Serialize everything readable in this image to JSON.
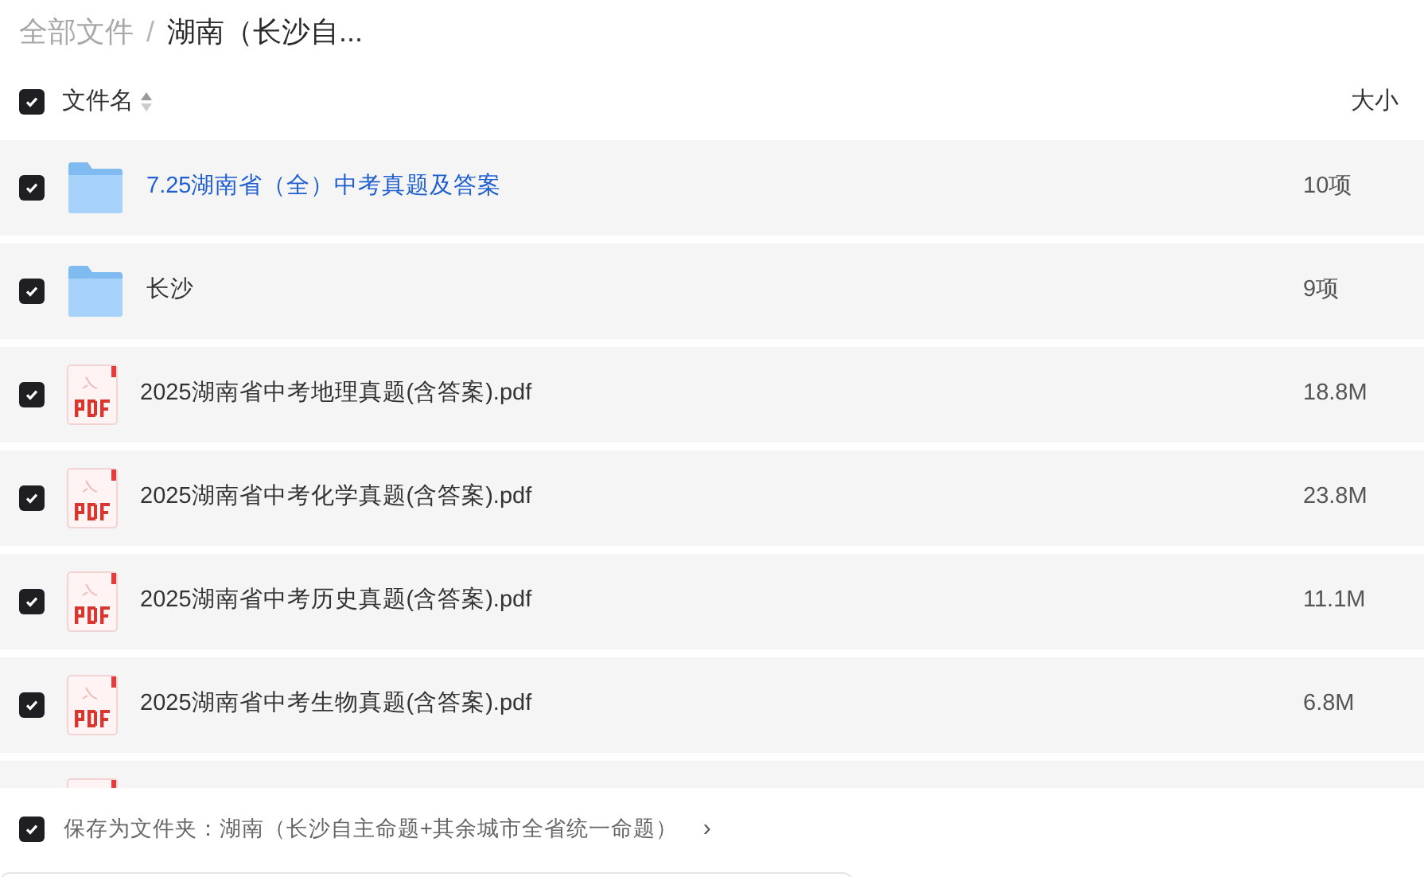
{
  "breadcrumb_separator": "/",
  "breadcrumb": [
    {
      "label": "全部文件",
      "current": false
    },
    {
      "label": "湖南（长沙自...",
      "current": true
    }
  ],
  "header": {
    "checked": true,
    "name_label": "文件名",
    "size_label": "大小"
  },
  "rows": [
    {
      "kind": "folder",
      "checked": true,
      "name": "7.25湖南省（全）中考真题及答案",
      "size": "10项",
      "highlighted": true
    },
    {
      "kind": "folder",
      "checked": true,
      "name": "长沙",
      "size": "9项",
      "highlighted": false
    },
    {
      "kind": "pdf",
      "checked": true,
      "name": "2025湖南省中考地理真题(含答案).pdf",
      "size": "18.8M",
      "highlighted": false
    },
    {
      "kind": "pdf",
      "checked": true,
      "name": "2025湖南省中考化学真题(含答案).pdf",
      "size": "23.8M",
      "highlighted": false
    },
    {
      "kind": "pdf",
      "checked": true,
      "name": "2025湖南省中考历史真题(含答案).pdf",
      "size": "11.1M",
      "highlighted": false
    },
    {
      "kind": "pdf",
      "checked": true,
      "name": "2025湖南省中考生物真题(含答案).pdf",
      "size": "6.8M",
      "highlighted": false
    },
    {
      "kind": "pdf"
    }
  ],
  "footer": {
    "checked": true,
    "label": "保存为文件夹：湖南（长沙自主命题+其余城市全省统一命题）",
    "chevron": "›"
  }
}
